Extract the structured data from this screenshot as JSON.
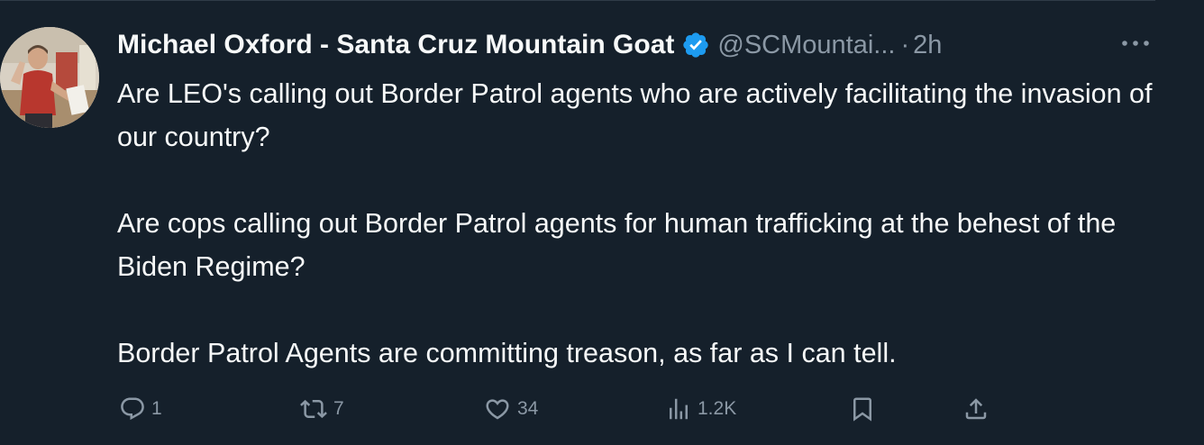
{
  "author": {
    "display_name": "Michael Oxford - Santa Cruz Mountain Goat",
    "handle": "@SCMountai...",
    "separator": "·",
    "time": "2h",
    "verified": true,
    "verified_color": "#1d9bf0"
  },
  "tweet": {
    "paragraphs": [
      "Are LEO's calling out Border Patrol agents who are actively facilitating the invasion of our country?",
      "Are cops calling out Border Patrol agents for human trafficking at the behest of the Biden Regime?",
      "Border Patrol Agents are committing treason, as far as I can tell."
    ]
  },
  "actions": {
    "reply": {
      "icon": "reply-icon",
      "count": "1"
    },
    "retweet": {
      "icon": "retweet-icon",
      "count": "7"
    },
    "like": {
      "icon": "heart-icon",
      "count": "34"
    },
    "views": {
      "icon": "views-icon",
      "count": "1.2K"
    },
    "bookmark": {
      "icon": "bookmark-icon"
    },
    "share": {
      "icon": "share-icon"
    }
  },
  "theme": {
    "background": "#15202b",
    "text": "#f7f9f9",
    "secondary_text": "#8b98a5"
  }
}
